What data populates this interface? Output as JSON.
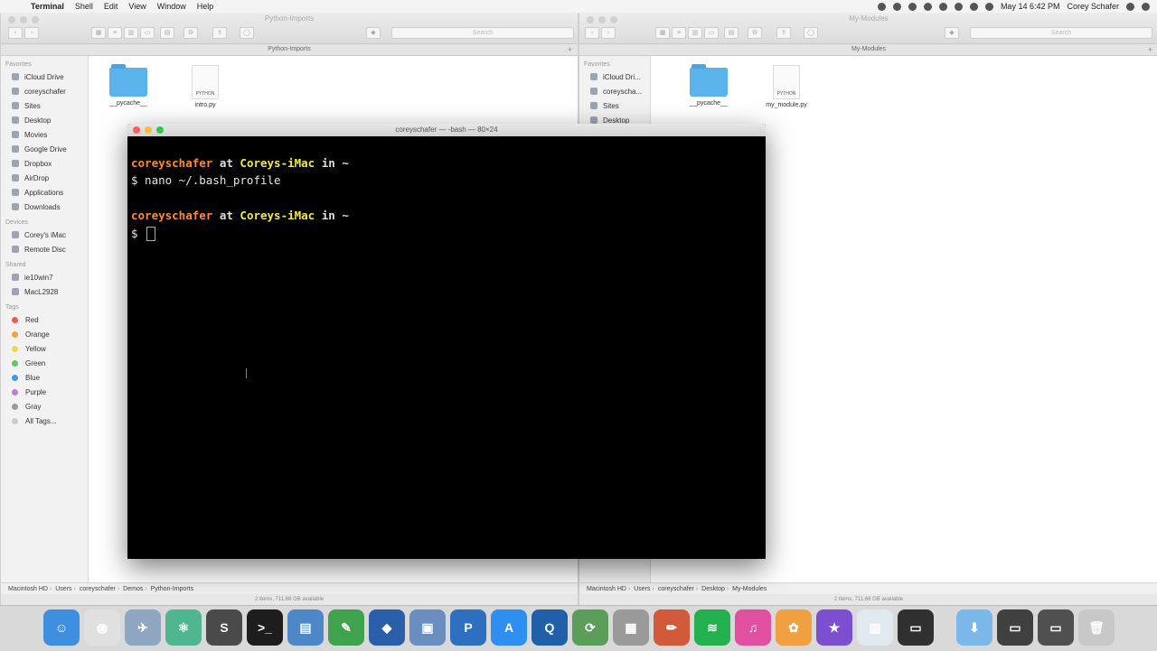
{
  "menubar": {
    "app": "Terminal",
    "items": [
      "Shell",
      "Edit",
      "View",
      "Window",
      "Help"
    ],
    "datetime": "May 14  6:42 PM",
    "user": "Corey Schafer"
  },
  "finder_left": {
    "window_title": "Python-Imports",
    "path_title": "Python-Imports",
    "search_placeholder": "Search",
    "sidebar": {
      "favorites_label": "Favorites",
      "favorites": [
        "iCloud Drive",
        "coreyschafer",
        "Sites",
        "Desktop",
        "Movies",
        "Google Drive",
        "Dropbox",
        "AirDrop",
        "Applications",
        "Downloads"
      ],
      "devices_label": "Devices",
      "devices": [
        "Corey's iMac",
        "Remote Disc"
      ],
      "shared_label": "Shared",
      "shared": [
        "ie10win7",
        "MacL2928"
      ],
      "tags_label": "Tags",
      "tags": [
        {
          "name": "Red",
          "color": "#f25a50"
        },
        {
          "name": "Orange",
          "color": "#f8a23c"
        },
        {
          "name": "Yellow",
          "color": "#f7d54a"
        },
        {
          "name": "Green",
          "color": "#5ccb5f"
        },
        {
          "name": "Blue",
          "color": "#3d9bf5"
        },
        {
          "name": "Purple",
          "color": "#c27ad6"
        },
        {
          "name": "Gray",
          "color": "#9b9b9b"
        }
      ],
      "all_tags": "All Tags..."
    },
    "files": [
      {
        "name": "__pycache__",
        "kind": "folder"
      },
      {
        "name": "intro.py",
        "kind": "python",
        "badge": "PYTHON"
      }
    ],
    "pathbar": [
      "Macintosh HD",
      "Users",
      "coreyschafer",
      "Demos",
      "Python-Imports"
    ],
    "status": "2 items, 711.68 GB available"
  },
  "finder_right": {
    "window_title": "My-Modules",
    "path_title": "My-Modules",
    "search_placeholder": "Search",
    "sidebar": {
      "favorites_label": "Favorites",
      "favorites": [
        "iCloud Dri...",
        "coreyscha...",
        "Sites",
        "Desktop"
      ]
    },
    "files": [
      {
        "name": "__pycache__",
        "kind": "folder"
      },
      {
        "name": "my_module.py",
        "kind": "python",
        "badge": "PYTHON"
      }
    ],
    "pathbar": [
      "Macintosh HD",
      "Users",
      "coreyschafer",
      "Desktop",
      "My-Modules"
    ],
    "status": "2 items, 711.68 GB available"
  },
  "terminal": {
    "title": "coreyschafer — -bash — 80×24",
    "prompt1": {
      "user": "coreyschafer",
      "at": " at ",
      "host": "Coreys-iMac",
      "in": " in ",
      "path": "~"
    },
    "cmd1": "$ nano ~/.bash_profile",
    "prompt2": {
      "user": "coreyschafer",
      "at": " at ",
      "host": "Coreys-iMac",
      "in": " in ",
      "path": "~"
    },
    "cmd2": "$ "
  },
  "dock": {
    "apps": [
      {
        "name": "finder-icon",
        "color": "#3f8fe0",
        "glyph": "☺"
      },
      {
        "name": "chrome-icon",
        "color": "#e0e0e0",
        "glyph": "◉"
      },
      {
        "name": "launchpad-icon",
        "color": "#8fa6c0",
        "glyph": "✈"
      },
      {
        "name": "atom-icon",
        "color": "#4fb68f",
        "glyph": "⚛"
      },
      {
        "name": "sublime-icon",
        "color": "#4a4a4a",
        "glyph": "S"
      },
      {
        "name": "terminal-icon",
        "color": "#1d1d1d",
        "glyph": ">_"
      },
      {
        "name": "preview-icon",
        "color": "#4d87c7",
        "glyph": "▤"
      },
      {
        "name": "evernote-icon",
        "color": "#3fa34d",
        "glyph": "✎"
      },
      {
        "name": "photoshop-icon",
        "color": "#2a5ea8",
        "glyph": "◆"
      },
      {
        "name": "virtualbox-icon",
        "color": "#6a8ec0",
        "glyph": "▣"
      },
      {
        "name": "pycharm-icon",
        "color": "#2f6fc0",
        "glyph": "P"
      },
      {
        "name": "appstore-icon",
        "color": "#2e8ff0",
        "glyph": "A"
      },
      {
        "name": "quicktime-icon",
        "color": "#2060a8",
        "glyph": "Q"
      },
      {
        "name": "network-icon",
        "color": "#5a9e5a",
        "glyph": "⟳"
      },
      {
        "name": "calculator-icon",
        "color": "#9a9a9a",
        "glyph": "▦"
      },
      {
        "name": "pencil-icon",
        "color": "#d05a3a",
        "glyph": "✏"
      },
      {
        "name": "spotify-icon",
        "color": "#23b04e",
        "glyph": "≋"
      },
      {
        "name": "itunes-icon",
        "color": "#e04fa0",
        "glyph": "♫"
      },
      {
        "name": "photos-icon",
        "color": "#f0a040",
        "glyph": "✿"
      },
      {
        "name": "imovie-icon",
        "color": "#7b4fd0",
        "glyph": "★"
      },
      {
        "name": "numbers-icon",
        "color": "#e0e8f0",
        "glyph": "▥"
      },
      {
        "name": "screenshot-icon",
        "color": "#303030",
        "glyph": "▭"
      }
    ],
    "right": [
      {
        "name": "downloads-folder-icon",
        "color": "#7ab8ea",
        "glyph": "⬇"
      },
      {
        "name": "window-thumb-icon",
        "color": "#404040",
        "glyph": "▭"
      },
      {
        "name": "window-thumb-2-icon",
        "color": "#505050",
        "glyph": "▭"
      },
      {
        "name": "trash-icon",
        "color": "#c8c8c8",
        "glyph": "🗑"
      }
    ]
  }
}
